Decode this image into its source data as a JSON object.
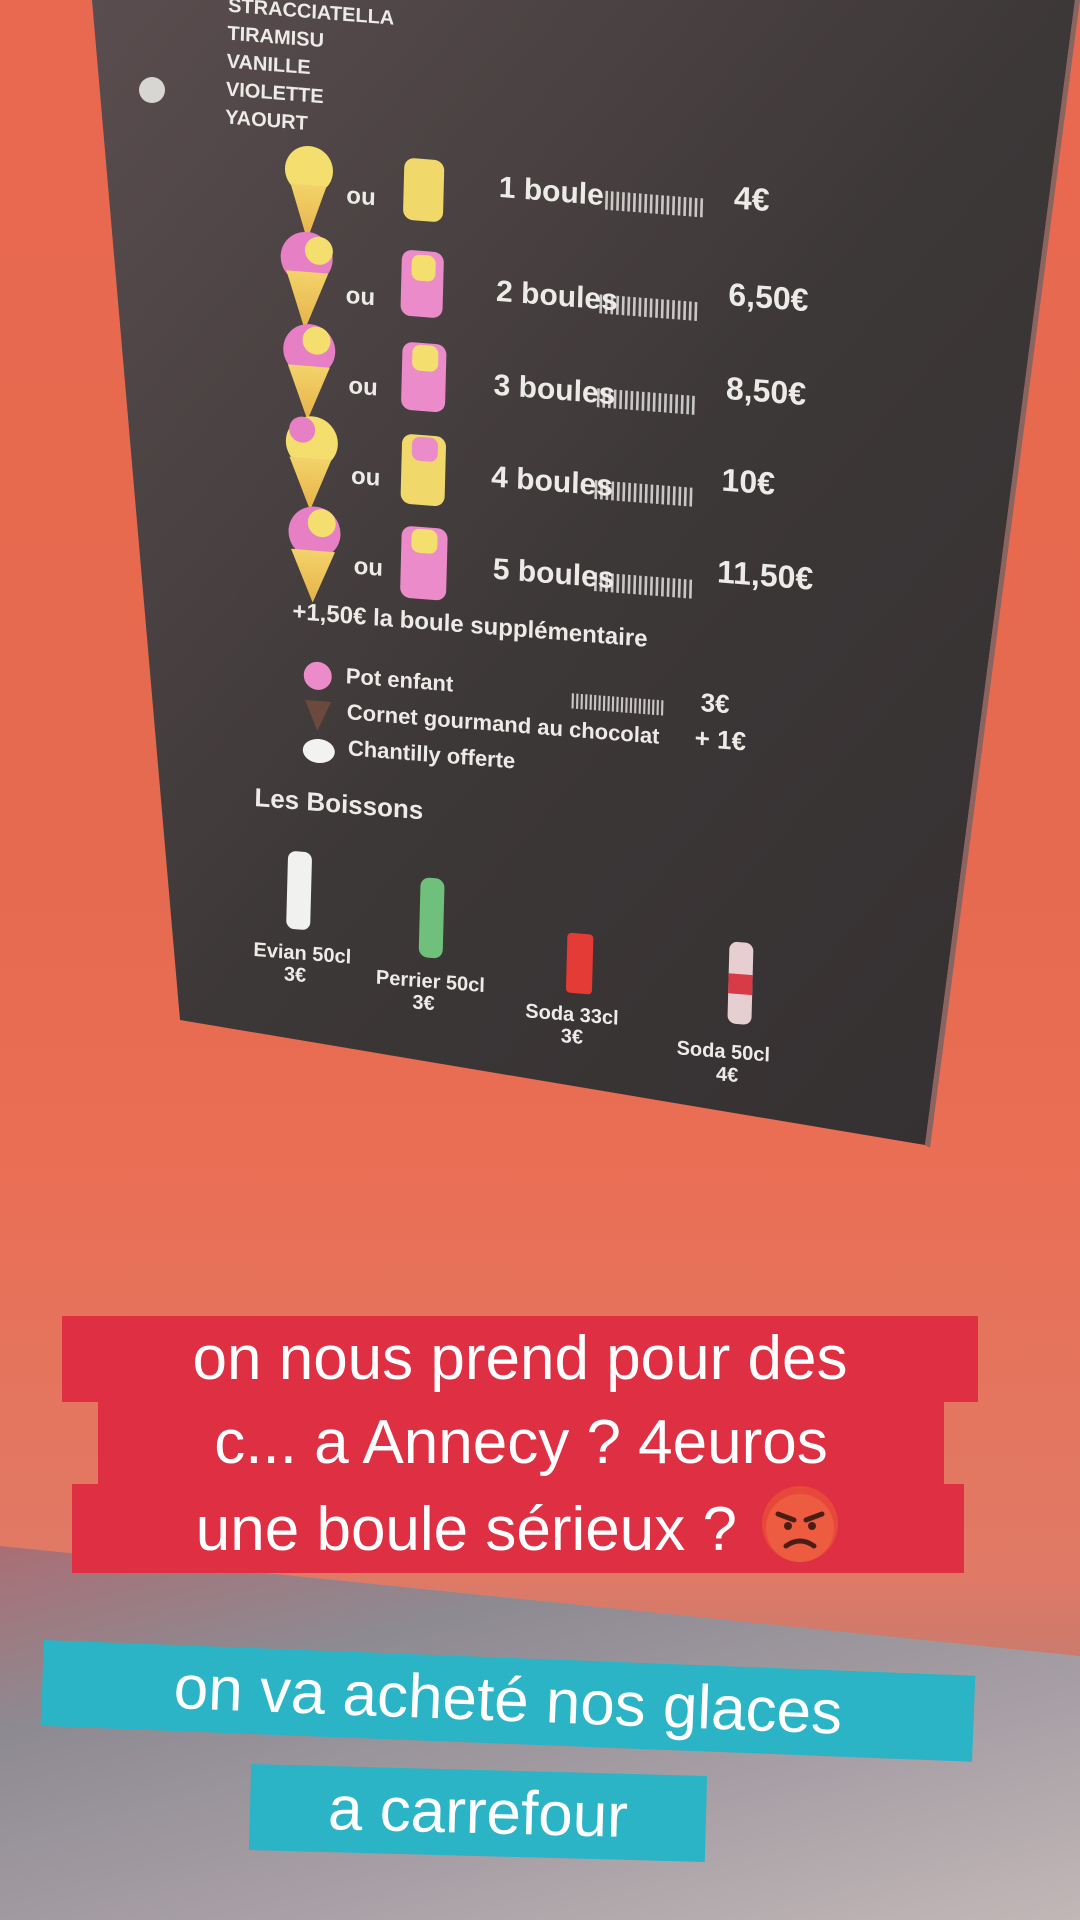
{
  "menu": {
    "flavors": [
      "STRACCIATELLA",
      "TIRAMISU",
      "VANILLE",
      "VIOLETTE",
      "YAOURT"
    ],
    "or_label": "ou",
    "scoops": [
      {
        "label": "1 boule",
        "price": "4€"
      },
      {
        "label": "2 boules",
        "price": "6,50€"
      },
      {
        "label": "3 boules",
        "price": "8,50€"
      },
      {
        "label": "4 boules",
        "price": "10€"
      },
      {
        "label": "5 boules",
        "price": "11,50€"
      }
    ],
    "extra_scoop": "+1,50€ la boule supplémentaire",
    "extras": [
      {
        "label": "Pot enfant",
        "price": "3€"
      },
      {
        "label": "Cornet gourmand au chocolat",
        "price": "+ 1€"
      },
      {
        "label": "Chantilly offerte",
        "price": ""
      }
    ],
    "drinks_title": "Les Boissons",
    "drinks": [
      {
        "name": "Evian 50cl",
        "price": "3€"
      },
      {
        "name": "Perrier 50cl",
        "price": "3€"
      },
      {
        "name": "Soda 33cl",
        "price": "3€"
      },
      {
        "name": "Soda 50cl",
        "price": "4€"
      }
    ]
  },
  "captions": {
    "red_lines": [
      "on nous prend pour des",
      "c... a Annecy ? 4euros",
      "une boule  sérieux ?"
    ],
    "red_emoji": "angry-face-emoji",
    "cyan_lines": [
      "on va acheté  nos glaces",
      "a carrefour"
    ]
  },
  "colors": {
    "wall": "#e8694f",
    "board": "#3e3838",
    "caption_red": "#de2f43",
    "caption_cyan": "#2bb3c6"
  }
}
